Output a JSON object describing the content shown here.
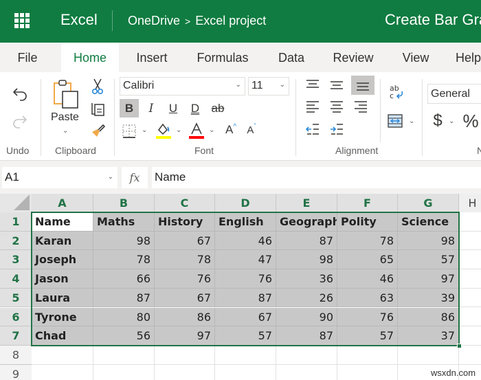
{
  "titlebar": {
    "app_name": "Excel",
    "breadcrumb": [
      "OneDrive",
      "Excel project"
    ],
    "breadcrumb_separator": ">",
    "doc_title": "Create Bar Graph",
    "brand_color": "#107c41"
  },
  "tabs": [
    {
      "label": "File",
      "active": false
    },
    {
      "label": "Home",
      "active": true
    },
    {
      "label": "Insert",
      "active": false
    },
    {
      "label": "Formulas",
      "active": false
    },
    {
      "label": "Data",
      "active": false
    },
    {
      "label": "Review",
      "active": false
    },
    {
      "label": "View",
      "active": false
    },
    {
      "label": "Help",
      "active": false
    }
  ],
  "ribbon": {
    "groups": {
      "undo": "Undo",
      "clipboard": "Clipboard",
      "font": "Font",
      "alignment": "Alignment",
      "number": "Number"
    },
    "paste_label": "Paste",
    "font_name": "Calibri",
    "font_size": "11",
    "number_format": "General",
    "bold_active": true,
    "format_buttons": [
      "B",
      "I",
      "U",
      "D",
      "ab"
    ],
    "currency_symbol": "$",
    "percent_symbol": "%",
    "fill_color": "#ffff00",
    "font_color": "#ff0000"
  },
  "formula_bar": {
    "name_box": "A1",
    "fx_label": "fx",
    "formula": "Name"
  },
  "sheet": {
    "columns": [
      "A",
      "B",
      "C",
      "D",
      "E",
      "F",
      "G",
      "H"
    ],
    "rows": [
      "1",
      "2",
      "3",
      "4",
      "5",
      "6",
      "7",
      "8",
      "9"
    ],
    "header": [
      "Name",
      "Maths",
      "History",
      "English",
      "Geography",
      "Polity",
      "Science"
    ],
    "data": [
      [
        "Karan",
        "98",
        "67",
        "46",
        "87",
        "78",
        "98"
      ],
      [
        "Joseph",
        "78",
        "78",
        "47",
        "98",
        "65",
        "57"
      ],
      [
        "Jason",
        "66",
        "76",
        "76",
        "36",
        "46",
        "97"
      ],
      [
        "Laura",
        "87",
        "67",
        "87",
        "26",
        "63",
        "39"
      ],
      [
        "Tyrone",
        "80",
        "86",
        "67",
        "90",
        "76",
        "86"
      ],
      [
        "Chad",
        "56",
        "97",
        "57",
        "87",
        "57",
        "37"
      ]
    ],
    "selection": "A1:G7",
    "active_cell": "A1"
  },
  "watermark": "wsxdn.com"
}
